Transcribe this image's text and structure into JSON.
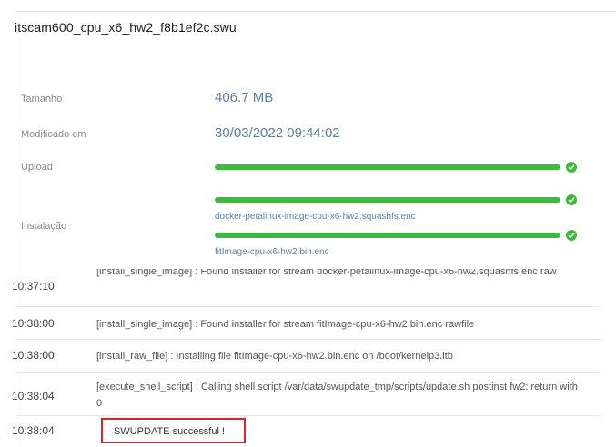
{
  "file": {
    "name": "itscam600_cpu_x6_hw2_f8b1ef2c.swu"
  },
  "info": {
    "size_label": "Tamanho",
    "size_value": "406.7 MB",
    "modified_label": "Modificado em",
    "modified_value": "30/03/2022 09:44:02",
    "upload_label": "Upload",
    "upload_progress": 1.0,
    "install_label": "Instalação",
    "install_items": [
      {
        "name": "docker-petalinux-image-cpu-x6-hw2.squashfs.enc",
        "progress": 1.0
      },
      {
        "name": "fitImage-cpu-x6-hw2.bin.enc",
        "progress": 1.0
      }
    ]
  },
  "colors": {
    "accent": "#5b7ea8",
    "progress": "#3fb83f",
    "highlight": "#d9262c"
  },
  "log": [
    {
      "time": "10:37:10",
      "message": "[install_single_image] : Found installer for stream docker-petalinux-image-cpu-x6-hw2.squashfs.enc raw"
    },
    {
      "time": "10:38:00",
      "message": "[install_single_image] : Found installer for stream fitImage-cpu-x6-hw2.bin.enc rawfile"
    },
    {
      "time": "10:38:00",
      "message": "[install_raw_file] : Installing file fitImage-cpu-x6-hw2.bin.enc on /boot/kernelp3.itb"
    },
    {
      "time": "10:38:04",
      "message": "[execute_shell_script] : Calling shell script /var/data/swupdate_tmp/scripts/update.sh postinst fw2: return with 0"
    },
    {
      "time": "10:38:04",
      "message": "SWUPDATE successful !"
    }
  ]
}
